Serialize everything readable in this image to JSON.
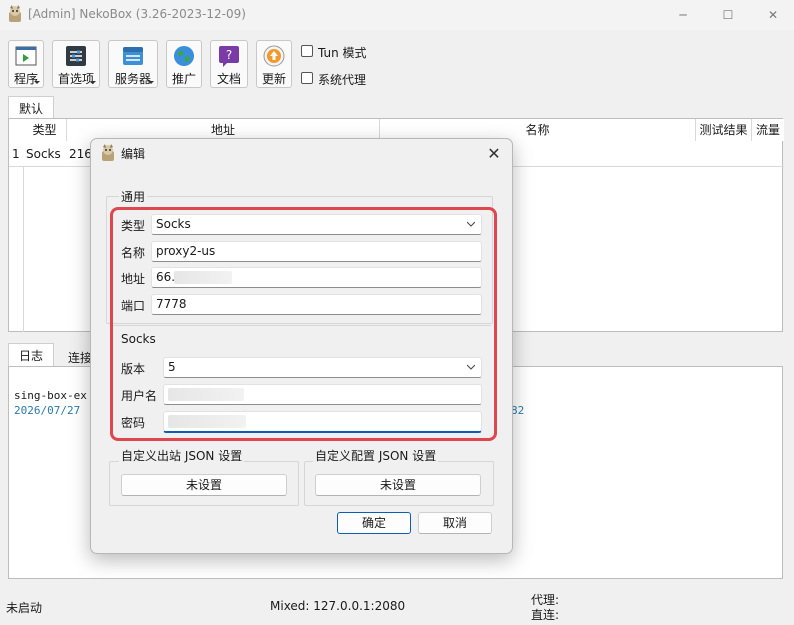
{
  "window": {
    "title": "[Admin] NekoBox (3.26-2023-12-09)",
    "minimize_glyph": "─",
    "maximize_glyph": "☐",
    "close_glyph": "✕"
  },
  "toolbar": {
    "buttons": [
      {
        "label": "程序",
        "icon": "terminal-icon"
      },
      {
        "label": "首选项",
        "icon": "preferences-icon"
      },
      {
        "label": "服务器",
        "icon": "server-icon"
      },
      {
        "label": "推广",
        "icon": "globe-icon"
      },
      {
        "label": "文档",
        "icon": "help-document-icon"
      },
      {
        "label": "更新",
        "icon": "update-icon"
      }
    ],
    "tun_label": "Tun 模式",
    "system_proxy_label": "系统代理"
  },
  "group_tab": "默认",
  "table": {
    "columns": [
      "类型",
      "地址",
      "名称",
      "测试结果",
      "流量"
    ],
    "rows": [
      {
        "index": "1",
        "type": "Socks",
        "address": "216"
      }
    ]
  },
  "bottom_tabs": [
    "日志",
    "连接"
  ],
  "log": {
    "line1": "sing-box-ex",
    "line2": "2026/07/27",
    "line2_tail": "82"
  },
  "status_bar": {
    "state": "未启动",
    "mixed": "Mixed: 127.0.0.1:2080",
    "proxy": "代理:",
    "direct": "直连:"
  },
  "dialog": {
    "title": "编辑",
    "close_glyph": "✕",
    "general_group": "通用",
    "type_label": "类型",
    "type_value": "Socks",
    "name_label": "名称",
    "name_value": "proxy2-us",
    "address_label": "地址",
    "address_value": "66.",
    "port_label": "端口",
    "port_value": "7778",
    "socks_group": "Socks",
    "version_label": "版本",
    "version_value": "5",
    "username_label": "用户名",
    "password_label": "密码",
    "outbound_json_group": "自定义出站 JSON 设置",
    "outbound_json_button": "未设置",
    "config_json_group": "自定义配置 JSON 设置",
    "config_json_button": "未设置",
    "ok_button": "确定",
    "cancel_button": "取消"
  },
  "colors": {
    "highlight_border": "#e0464d",
    "focus_accent": "#0a5fb4",
    "log_timestamp": "#2a7ab0"
  }
}
